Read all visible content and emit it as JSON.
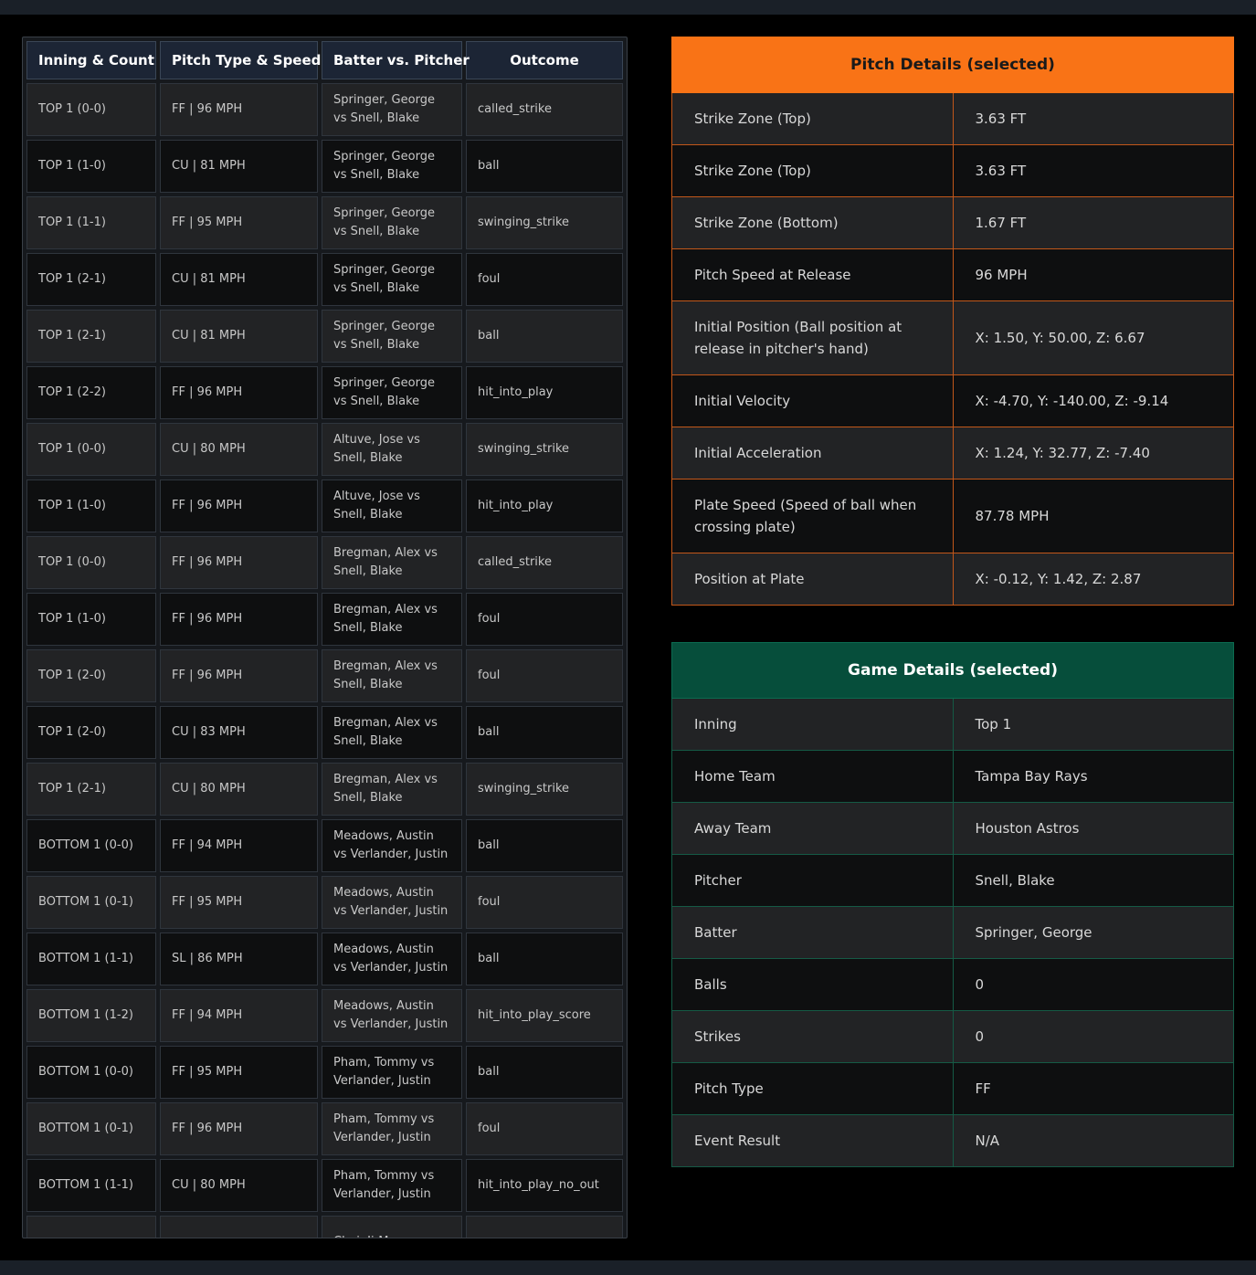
{
  "pitch_list": {
    "headers": [
      "Inning & Count",
      "Pitch Type & Speed",
      "Batter vs. Pitcher",
      "Outcome"
    ],
    "rows": [
      {
        "inning": "TOP 1 (0-0)",
        "pitch": "FF | 96 MPH",
        "matchup": "Springer, George vs Snell, Blake",
        "outcome": "called_strike"
      },
      {
        "inning": "TOP 1 (1-0)",
        "pitch": "CU | 81 MPH",
        "matchup": "Springer, George vs Snell, Blake",
        "outcome": "ball"
      },
      {
        "inning": "TOP 1 (1-1)",
        "pitch": "FF | 95 MPH",
        "matchup": "Springer, George vs Snell, Blake",
        "outcome": "swinging_strike"
      },
      {
        "inning": "TOP 1 (2-1)",
        "pitch": "CU | 81 MPH",
        "matchup": "Springer, George vs Snell, Blake",
        "outcome": "foul"
      },
      {
        "inning": "TOP 1 (2-1)",
        "pitch": "CU | 81 MPH",
        "matchup": "Springer, George vs Snell, Blake",
        "outcome": "ball"
      },
      {
        "inning": "TOP 1 (2-2)",
        "pitch": "FF | 96 MPH",
        "matchup": "Springer, George vs Snell, Blake",
        "outcome": "hit_into_play"
      },
      {
        "inning": "TOP 1 (0-0)",
        "pitch": "CU | 80 MPH",
        "matchup": "Altuve, Jose vs Snell, Blake",
        "outcome": "swinging_strike"
      },
      {
        "inning": "TOP 1 (1-0)",
        "pitch": "FF | 96 MPH",
        "matchup": "Altuve, Jose vs Snell, Blake",
        "outcome": "hit_into_play"
      },
      {
        "inning": "TOP 1 (0-0)",
        "pitch": "FF | 96 MPH",
        "matchup": "Bregman, Alex vs Snell, Blake",
        "outcome": "called_strike"
      },
      {
        "inning": "TOP 1 (1-0)",
        "pitch": "FF | 96 MPH",
        "matchup": "Bregman, Alex vs Snell, Blake",
        "outcome": "foul"
      },
      {
        "inning": "TOP 1 (2-0)",
        "pitch": "FF | 96 MPH",
        "matchup": "Bregman, Alex vs Snell, Blake",
        "outcome": "foul"
      },
      {
        "inning": "TOP 1 (2-0)",
        "pitch": "CU | 83 MPH",
        "matchup": "Bregman, Alex vs Snell, Blake",
        "outcome": "ball"
      },
      {
        "inning": "TOP 1 (2-1)",
        "pitch": "CU | 80 MPH",
        "matchup": "Bregman, Alex vs Snell, Blake",
        "outcome": "swinging_strike"
      },
      {
        "inning": "BOTTOM 1 (0-0)",
        "pitch": "FF | 94 MPH",
        "matchup": "Meadows, Austin vs Verlander, Justin",
        "outcome": "ball"
      },
      {
        "inning": "BOTTOM 1 (0-1)",
        "pitch": "FF | 95 MPH",
        "matchup": "Meadows, Austin vs Verlander, Justin",
        "outcome": "foul"
      },
      {
        "inning": "BOTTOM 1 (1-1)",
        "pitch": "SL | 86 MPH",
        "matchup": "Meadows, Austin vs Verlander, Justin",
        "outcome": "ball"
      },
      {
        "inning": "BOTTOM 1 (1-2)",
        "pitch": "FF | 94 MPH",
        "matchup": "Meadows, Austin vs Verlander, Justin",
        "outcome": "hit_into_play_score"
      },
      {
        "inning": "BOTTOM 1 (0-0)",
        "pitch": "FF | 95 MPH",
        "matchup": "Pham, Tommy vs Verlander, Justin",
        "outcome": "ball"
      },
      {
        "inning": "BOTTOM 1 (0-1)",
        "pitch": "FF | 96 MPH",
        "matchup": "Pham, Tommy vs Verlander, Justin",
        "outcome": "foul"
      },
      {
        "inning": "BOTTOM 1 (1-1)",
        "pitch": "CU | 80 MPH",
        "matchup": "Pham, Tommy vs Verlander, Justin",
        "outcome": "hit_into_play_no_out"
      },
      {
        "inning": "",
        "pitch": "",
        "matchup": "Choi, Ji-Man vs",
        "outcome": ""
      }
    ]
  },
  "pitch_details": {
    "title": "Pitch Details (selected)",
    "rows": [
      {
        "label": "Strike Zone (Top)",
        "value": "3.63 FT"
      },
      {
        "label": "Strike Zone (Top)",
        "value": "3.63 FT"
      },
      {
        "label": "Strike Zone (Bottom)",
        "value": "1.67 FT"
      },
      {
        "label": "Pitch Speed at Release",
        "value": "96 MPH"
      },
      {
        "label": "Initial Position (Ball position at release in pitcher's hand)",
        "value": "X: 1.50, Y: 50.00, Z: 6.67"
      },
      {
        "label": "Initial Velocity",
        "value": "X: -4.70, Y: -140.00, Z: -9.14"
      },
      {
        "label": "Initial Acceleration",
        "value": "X: 1.24, Y: 32.77, Z: -7.40"
      },
      {
        "label": "Plate Speed (Speed of ball when crossing plate)",
        "value": "87.78 MPH"
      },
      {
        "label": "Position at Plate",
        "value": "X: -0.12, Y: 1.42, Z: 2.87"
      }
    ]
  },
  "game_details": {
    "title": "Game Details (selected)",
    "rows": [
      {
        "label": "Inning",
        "value": "Top 1"
      },
      {
        "label": "Home Team",
        "value": "Tampa Bay Rays"
      },
      {
        "label": "Away Team",
        "value": "Houston Astros"
      },
      {
        "label": "Pitcher",
        "value": "Snell, Blake"
      },
      {
        "label": "Batter",
        "value": "Springer, George"
      },
      {
        "label": "Balls",
        "value": "0"
      },
      {
        "label": "Strikes",
        "value": "0"
      },
      {
        "label": "Pitch Type",
        "value": "FF"
      },
      {
        "label": "Event Result",
        "value": "N/A"
      }
    ]
  }
}
